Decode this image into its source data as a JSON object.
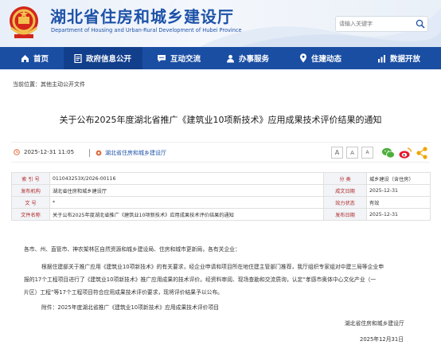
{
  "header": {
    "site_title": "湖北省住房和城乡建设厅",
    "site_subtitle": "Department of Housing and Urban-Rural Development of Hubei Province",
    "search_placeholder": "请输入关键字"
  },
  "nav": {
    "items": [
      {
        "label": "首页",
        "icon": "home-icon"
      },
      {
        "label": "政府信息公开",
        "icon": "document-icon"
      },
      {
        "label": "互动交流",
        "icon": "chat-icon"
      },
      {
        "label": "办事服务",
        "icon": "user-service-icon"
      },
      {
        "label": "住建动态",
        "icon": "location-icon"
      },
      {
        "label": "数据开放",
        "icon": "data-icon"
      }
    ],
    "active_index": 1
  },
  "breadcrumb": {
    "prefix": "当前位置：",
    "current": "其他主动公开文件"
  },
  "article": {
    "title": "关于公布2025年度湖北省推广《建筑业10项新技术》应用成果技术评价结果的通知",
    "date": "2025-12-31 11:05",
    "source": "湖北省住房和城乡建设厅",
    "font_sizes": [
      "A",
      "A",
      "A"
    ]
  },
  "info_table": {
    "rows": [
      {
        "l1": "索 引 号",
        "v1": "011043253X/2026-00116",
        "l2": "分 类",
        "v2": "城乡建设（含住房）"
      },
      {
        "l1": "发布机构",
        "v1": "湖北省住房和城乡建设厅",
        "l2": "成文日期",
        "v2": "2025-12-31"
      },
      {
        "l1": "文 号",
        "v1": "*",
        "l2": "效力状态",
        "v2": "有效"
      },
      {
        "l1": "文件名称",
        "v1": "关于公布2025年度湖北省推广《建筑业10项新技术》应用成果技术评价结果的通知",
        "l2": "发布日期",
        "v2": "2025-12-31"
      }
    ]
  },
  "body": {
    "salutation": "各市、州、直管市、神农架林区自然资源和城乡建设局、住房和城市更新局，各有关企业：",
    "para1_line1": "根据住建部关于推广应用《建筑业10项新技术》的有关要求，经企业申请和项目所在地住建主管部门推荐，我厅组织专家组对中建三局等企业申",
    "para1_line2": "报的17个工程项目进行了《建筑业10项新技术》推广应用成果的技术评价。经资料审阅、现场查勘和交流质询，认定“孝感市奥体中心文化产业（一",
    "para1_line3": "片区）工程”等17个工程项目符合应用成果技术评价要求，现将评价结果予以公布。",
    "attachment": "附件：2025年度湖北省推广《建筑业10项新技术》应用成果技术评价项目",
    "signature": "湖北省住房和城乡建设厅",
    "sign_date": "2025年12月31日"
  },
  "colors": {
    "brand_blue": "#1a4ea3",
    "label_red": "#b0282a"
  }
}
